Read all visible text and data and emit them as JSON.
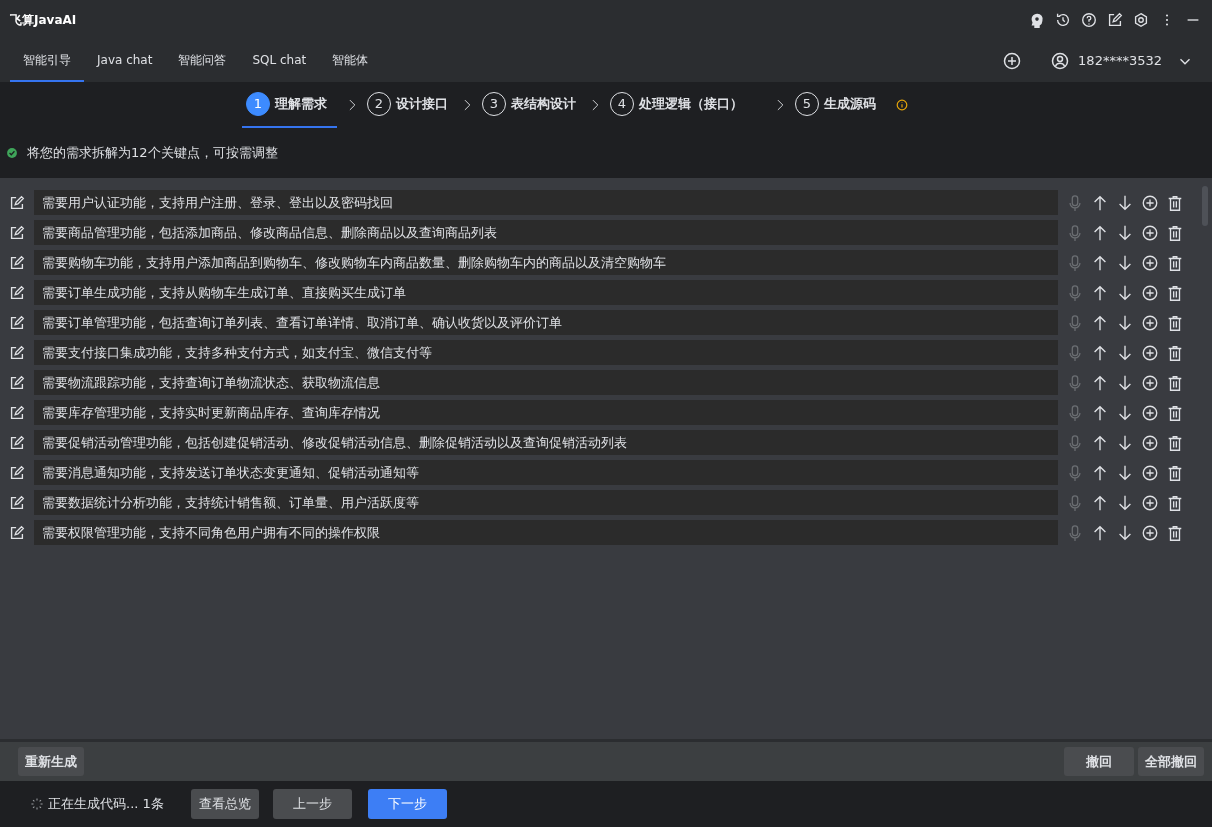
{
  "window": {
    "title": "飞算JavaAI"
  },
  "tabs": [
    {
      "label": "智能引导",
      "selected": true
    },
    {
      "label": "Java chat",
      "selected": false
    },
    {
      "label": "智能问答",
      "selected": false
    },
    {
      "label": "SQL chat",
      "selected": false
    },
    {
      "label": "智能体",
      "selected": false
    }
  ],
  "account": {
    "phone": "182****3532"
  },
  "steps": [
    {
      "number": "1",
      "label": "理解需求",
      "selected": true
    },
    {
      "number": "2",
      "label": "设计接口",
      "selected": false
    },
    {
      "number": "3",
      "label": "表结构设计",
      "selected": false
    },
    {
      "number": "4",
      "label": "处理逻辑（接口）",
      "selected": false
    },
    {
      "number": "5",
      "label": "生成源码",
      "selected": false
    }
  ],
  "notice": "将您的需求拆解为12个关键点，可按需调整",
  "requirements": [
    "需要用户认证功能，支持用户注册、登录、登出以及密码找回",
    "需要商品管理功能，包括添加商品、修改商品信息、删除商品以及查询商品列表",
    "需要购物车功能，支持用户添加商品到购物车、修改购物车内商品数量、删除购物车内的商品以及清空购物车",
    "需要订单生成功能，支持从购物车生成订单、直接购买生成订单",
    "需要订单管理功能，包括查询订单列表、查看订单详情、取消订单、确认收货以及评价订单",
    "需要支付接口集成功能，支持多种支付方式，如支付宝、微信支付等",
    "需要物流跟踪功能，支持查询订单物流状态、获取物流信息",
    "需要库存管理功能，支持实时更新商品库存、查询库存情况",
    "需要促销活动管理功能，包括创建促销活动、修改促销活动信息、删除促销活动以及查询促销活动列表",
    "需要消息通知功能，支持发送订单状态变更通知、促销活动通知等",
    "需要数据统计分析功能，支持统计销售额、订单量、用户活跃度等",
    "需要权限管理功能，支持不同角色用户拥有不同的操作权限"
  ],
  "toolbar": {
    "regenerate": "重新生成",
    "undo": "撤回",
    "undo_all": "全部撤回"
  },
  "footer": {
    "status": "正在生成代码...",
    "count": "1条",
    "overview": "查看总览",
    "prev": "上一步",
    "next": "下一步"
  }
}
